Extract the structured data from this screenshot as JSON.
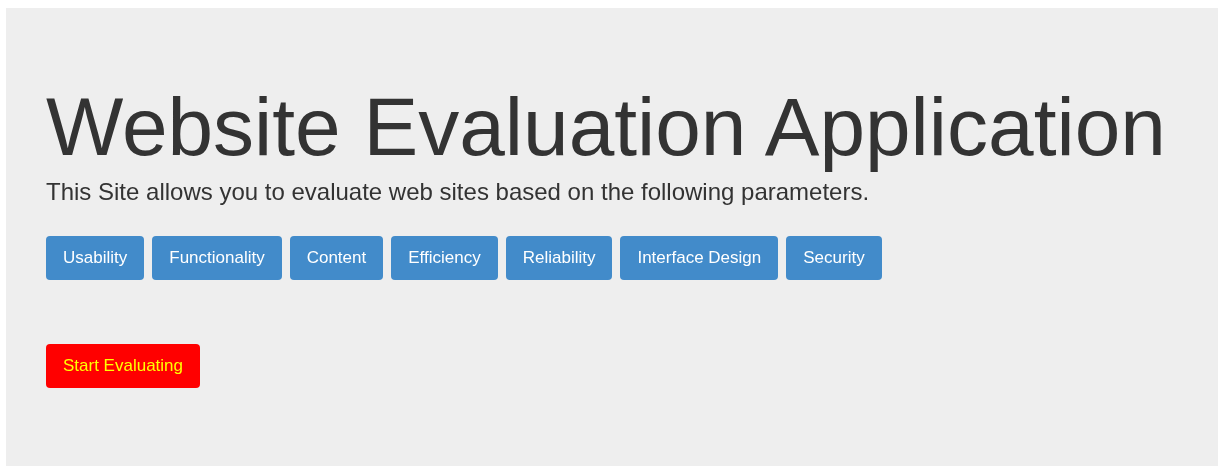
{
  "heading": "Website Evaluation Application",
  "description": "This Site allows you to evaluate web sites based on the following parameters.",
  "parameters": [
    "Usability",
    "Functionality",
    "Content",
    "Efficiency",
    "Reliability",
    "Interface Design",
    "Security"
  ],
  "start_button": "Start Evaluating"
}
